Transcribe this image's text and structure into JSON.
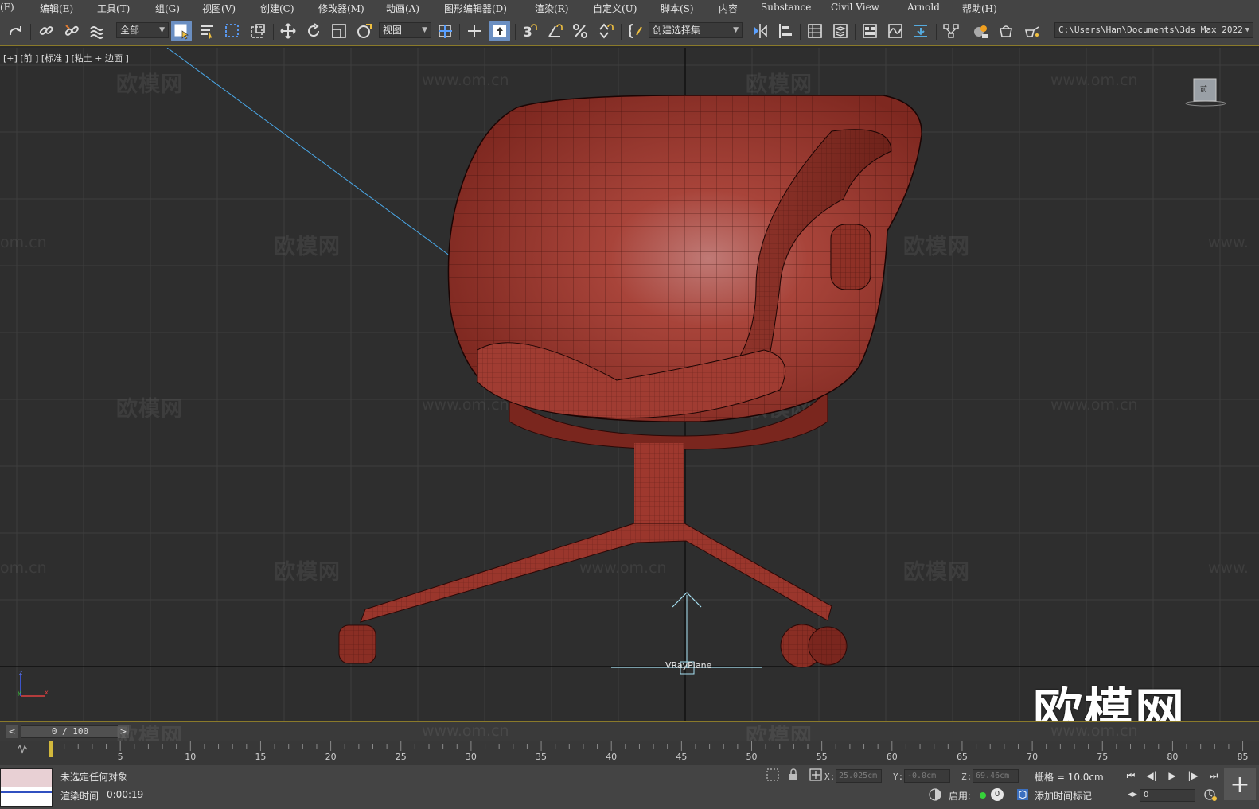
{
  "menu": {
    "items": [
      "(F)",
      "编辑(E)",
      "工具(T)",
      "组(G)",
      "视图(V)",
      "创建(C)",
      "修改器(M)",
      "动画(A)",
      "图形编辑器(D)",
      "渲染(R)",
      "自定义(U)",
      "脚本(S)",
      "内容",
      "Substance",
      "Civil View",
      "Arnold",
      "帮助(H)"
    ]
  },
  "toolbar": {
    "selection_filter": "全部",
    "ref_coord": "视图",
    "named_selection": "创建选择集",
    "project_path": "C:\\Users\\Han\\Documents\\3ds Max 2022",
    "snap_label": "3",
    "icons": [
      "redo-icon",
      "link-icon",
      "unlink-icon",
      "bind-space-warp-icon",
      "select-object-icon",
      "select-by-name-icon",
      "rect-select-region-icon",
      "window-crossing-icon",
      "select-move-icon",
      "select-rotate-icon",
      "select-scale-icon",
      "select-place-icon",
      "use-pivot-icon",
      "keyboard-shortcut-override-icon",
      "snaps-toggle-icon",
      "angle-snap-icon",
      "percent-snap-icon",
      "spinner-snap-icon",
      "edit-named-selection-icon",
      "mirror-icon",
      "align-icon",
      "scene-explorer-icon",
      "layer-explorer-icon",
      "toggle-ribbon-icon",
      "curve-editor-icon",
      "dope-sheet-icon",
      "schematic-view-icon",
      "material-editor-icon",
      "render-setup-icon",
      "rendered-frame-window-icon",
      "render-production-icon"
    ]
  },
  "viewport": {
    "label": "[+] [前 ] [标准 ] [粘土 + 边面 ]",
    "object_label": "VRayPlane",
    "viewcube_label": "前",
    "watermark_cn": "欧模网",
    "watermark_url": "www.om.cn",
    "watermark_partial_left": "om.cn",
    "watermark_partial_right": "www.",
    "logo": "欧模网",
    "axis_z": "z",
    "axis_y": "y",
    "axis_x": "x"
  },
  "timeslider": {
    "frame_display": "0 / 100",
    "prev": "<",
    "next": ">"
  },
  "trackbar": {
    "ticks": [
      0,
      5,
      10,
      15,
      20,
      25,
      30,
      35,
      40,
      45,
      50,
      55,
      60,
      65,
      70,
      75,
      80,
      85
    ],
    "current_frame": 0
  },
  "status": {
    "selection_text": "未选定任何对象",
    "render_time_label": "渲染时间",
    "render_time": "0:00:19",
    "x_label": "X:",
    "x_value": "25.025cm",
    "y_label": "Y:",
    "y_value": "-0.0cm",
    "z_label": "Z:",
    "z_value": "69.46cm",
    "grid_label": "栅格 = 10.0cm",
    "enabled_label": "启用:",
    "enabled_value": "0",
    "add_time_tag": "添加时间标记",
    "frame_value": "0",
    "add_key": "+"
  },
  "colors": {
    "accent_yellow": "#8a7a2a",
    "model_red": "#a33a30",
    "active_blue": "#6b8fc2"
  }
}
